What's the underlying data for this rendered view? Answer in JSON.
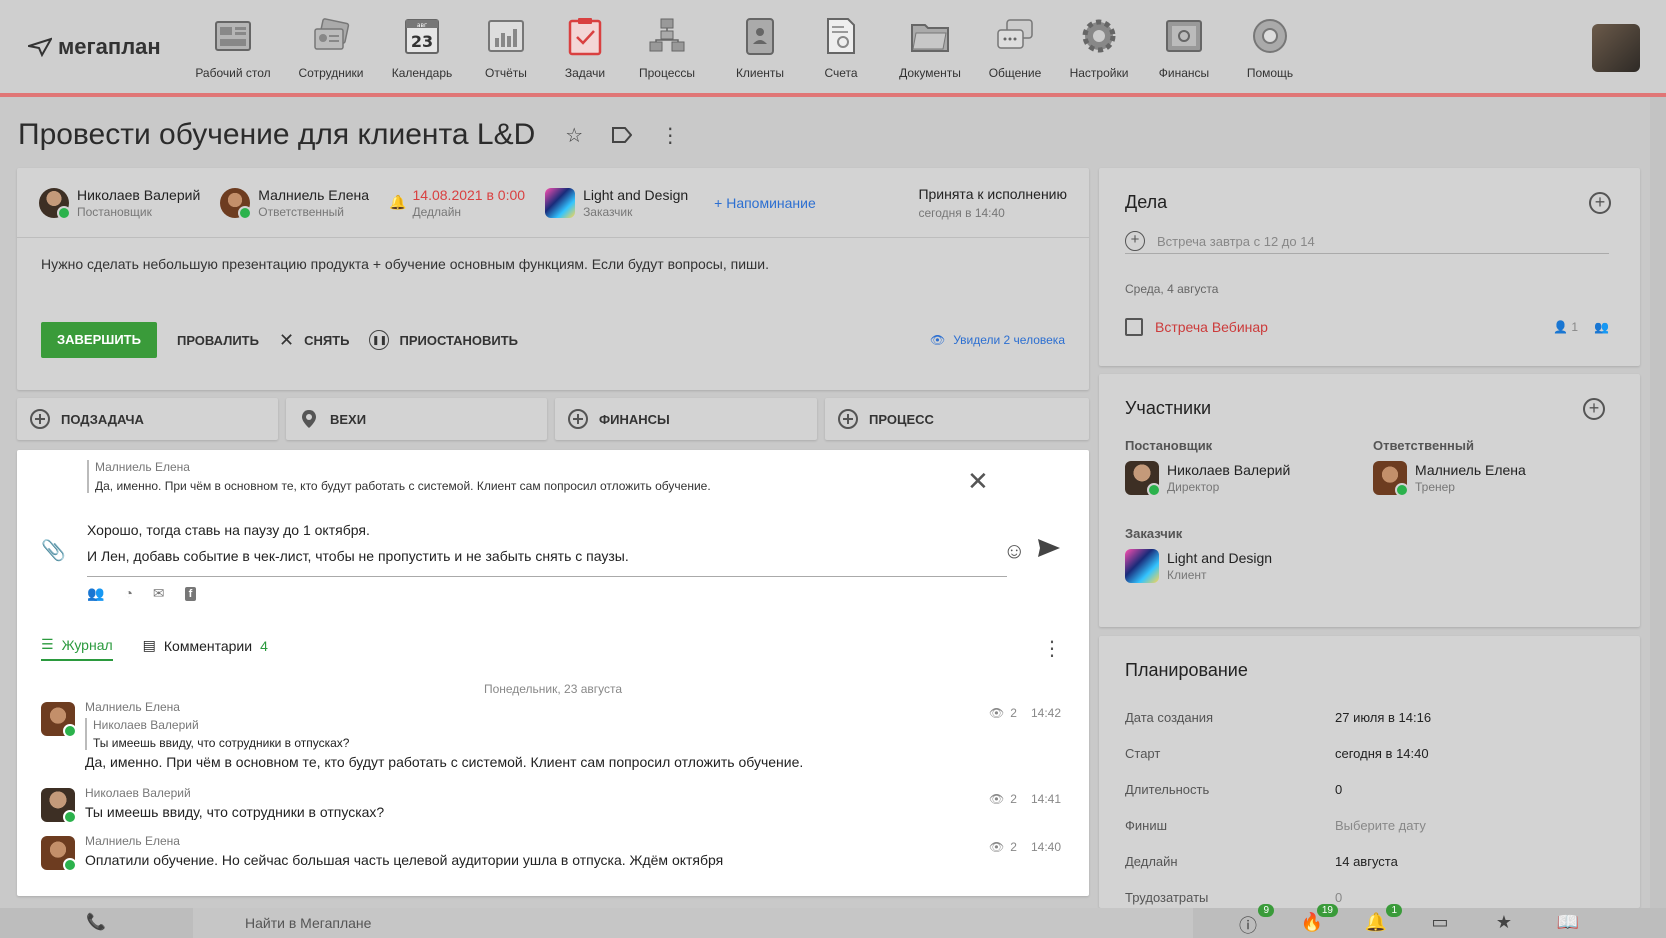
{
  "logo": {
    "text": "мегаплан"
  },
  "nav": [
    {
      "label": "Рабочий стол",
      "icon": "desktop-icon"
    },
    {
      "label": "Сотрудники",
      "icon": "employees-icon"
    },
    {
      "label": "Календарь",
      "icon": "calendar-icon",
      "day": "23",
      "month": "авг"
    },
    {
      "label": "Отчёты",
      "icon": "reports-icon"
    },
    {
      "label": "Задачи",
      "icon": "tasks-icon"
    },
    {
      "label": "Процессы",
      "icon": "processes-icon"
    },
    {
      "label": "Клиенты",
      "icon": "clients-icon"
    },
    {
      "label": "Счета",
      "icon": "invoices-icon"
    },
    {
      "label": "Документы",
      "icon": "documents-icon"
    },
    {
      "label": "Общение",
      "icon": "chat-icon"
    },
    {
      "label": "Настройки",
      "icon": "settings-icon"
    },
    {
      "label": "Финансы",
      "icon": "finance-icon"
    },
    {
      "label": "Помощь",
      "icon": "help-icon"
    }
  ],
  "task": {
    "title": "Провести обучение для клиента L&D",
    "setter": {
      "name": "Николаев Валерий",
      "role": "Постановщик"
    },
    "responsible": {
      "name": "Малниель Елена",
      "role": "Ответственный"
    },
    "deadline": {
      "value": "14.08.2021 в 0:00",
      "label": "Дедлайн"
    },
    "client": {
      "name": "Light and Design",
      "role": "Заказчик"
    },
    "reminder": "+ Напоминание",
    "status": {
      "text": "Принята к исполнению",
      "time": "сегодня в 14:40"
    },
    "description": "Нужно сделать небольшую презентацию продукта + обучение основным функциям. Если будут вопросы, пиши.",
    "actions": {
      "finish": "ЗАВЕРШИТЬ",
      "fail": "ПРОВАЛИТЬ",
      "remove": "СНЯТЬ",
      "pause": "ПРИОСТАНОВИТЬ",
      "seen": "Увидели 2 человека"
    }
  },
  "subbar": {
    "subtask": "ПОДЗАДАЧА",
    "milestones": "ВЕХИ",
    "finance": "ФИНАНСЫ",
    "process": "ПРОЦЕСС"
  },
  "editor": {
    "quote_author": "Малниель Елена",
    "quote_text": "Да, именно. При чём в основном те, кто будут работать с системой. Клиент сам попросил отложить обучение.",
    "line1": "Хорошо, тогда ставь на паузу до 1 октября.",
    "line2": "И Лен, добавь событие в чек-лист, чтобы не пропустить и не забыть снять с паузы."
  },
  "tabs": {
    "journal": "Журнал",
    "comments": "Комментарии",
    "comments_count": "4"
  },
  "feed": {
    "day": "Понедельник, 23 августа",
    "entries": [
      {
        "author": "Малниель Елена",
        "quote_author": "Николаев Валерий",
        "quote_text": "Ты имеешь ввиду, что сотрудники в отпусках?",
        "text": "Да, именно. При чём в основном те, кто будут работать с системой. Клиент сам попросил отложить обучение.",
        "views": "2",
        "time": "14:42"
      },
      {
        "author": "Николаев Валерий",
        "text": "Ты имеешь ввиду, что сотрудники в отпусках?",
        "views": "2",
        "time": "14:41"
      },
      {
        "author": "Малниель Елена",
        "text": "Оплатили обучение. Но сейчас большая часть целевой аудитории ушла в отпуска. Ждём октября",
        "views": "2",
        "time": "14:40"
      }
    ]
  },
  "todos": {
    "title": "Дела",
    "placeholder": "Встреча завтра с 12 до 14",
    "day": "Среда, 4 августа",
    "item": {
      "text": "Встреча Вебинар",
      "count": "1"
    }
  },
  "participants": {
    "title": "Участники",
    "setter": {
      "heading": "Постановщик",
      "name": "Николаев Валерий",
      "role": "Директор"
    },
    "responsible": {
      "heading": "Ответственный",
      "name": "Малниель Елена",
      "role": "Тренер"
    },
    "client": {
      "heading": "Заказчик",
      "name": "Light and Design",
      "role": "Клиент"
    }
  },
  "planning": {
    "title": "Планирование",
    "rows": [
      {
        "k": "Дата создания",
        "v": "27 июля в 14:16"
      },
      {
        "k": "Старт",
        "v": "сегодня в 14:40"
      },
      {
        "k": "Длительность",
        "v": "0"
      },
      {
        "k": "Финиш",
        "v": "Выберите дату"
      },
      {
        "k": "Дедлайн",
        "v": "14 августа"
      },
      {
        "k": "Трудозатраты",
        "v": "0"
      }
    ]
  },
  "bottom": {
    "search": "Найти в Мегаплане",
    "badges": {
      "alerts": "9",
      "hot": "19",
      "notifications": "1"
    }
  },
  "colors": {
    "accent": "#3a9b3a",
    "danger": "#d94040",
    "link": "#2c6fd1"
  }
}
